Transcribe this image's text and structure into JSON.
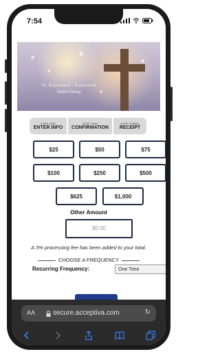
{
  "status": {
    "time": "7:54"
  },
  "hero": {
    "title": "St. Raymond - Raymond",
    "subtitle": "Online Giving"
  },
  "steps": [
    {
      "small": "STEP ONE",
      "label": "ENTER INFO"
    },
    {
      "small": "STEP TWO",
      "label": "CONFIRMATION"
    },
    {
      "small": "STEP THREE",
      "label": "RECEIPT"
    }
  ],
  "amounts": [
    "$25",
    "$50",
    "$75",
    "$100",
    "$250",
    "$500",
    "$625",
    "$1,000"
  ],
  "other": {
    "label": "Other Amount",
    "placeholder": "$0.00"
  },
  "fee_note": "A 3% processing fee has been added to your total.",
  "frequency": {
    "title": "CHOOSE A FREQUENCY",
    "label": "Recurring Frequency:",
    "selected": "One Time"
  },
  "browser": {
    "aa": "AA",
    "url": "secure.acceptiva.com"
  },
  "colors": {
    "border": "#1f2a44",
    "accent": "#1f3a8a",
    "step_bg": "#d8d8d8"
  }
}
